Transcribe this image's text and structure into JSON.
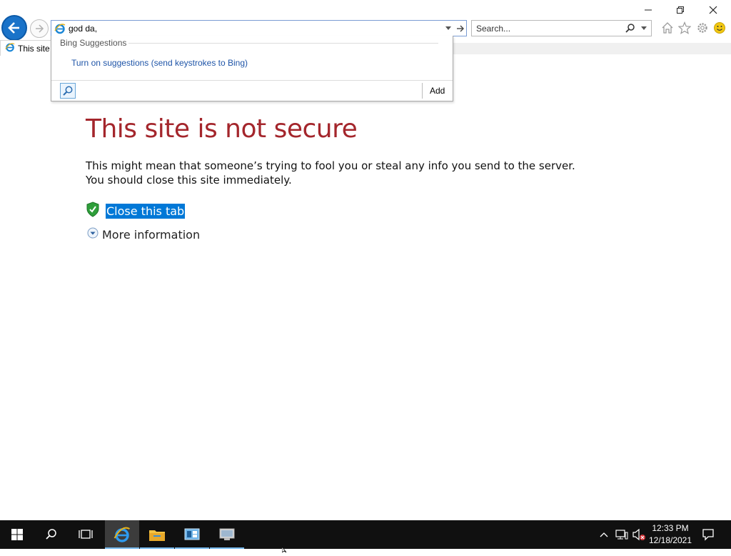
{
  "browser": {
    "address_value": "god da,",
    "search_placeholder": "Search...",
    "tab_title": "This site is not secure"
  },
  "suggestions": {
    "heading": "Bing Suggestions",
    "link": "Turn on suggestions (send keystrokes to Bing)",
    "add_label": "Add"
  },
  "page": {
    "title": "This site is not secure",
    "body": "This might mean that someone’s trying to fool you or steal any info you send to the server. You should close this site immediately.",
    "close_tab": "Close this tab",
    "more_info": "More information"
  },
  "taskbar": {
    "time": "12:33 PM",
    "date": "12/18/2021"
  },
  "colors": {
    "title_red": "#a4262c",
    "selection_blue": "#0078d7",
    "link_blue": "#1f55a8",
    "back_button": "#1a73c9",
    "taskbar": "#101010"
  },
  "icons": {
    "back": "back-arrow-icon",
    "forward": "forward-arrow-icon",
    "ie": "internet-explorer-icon",
    "home": "home-icon",
    "favorites": "star-icon",
    "tools": "gear-icon",
    "feedback": "smiley-icon"
  }
}
